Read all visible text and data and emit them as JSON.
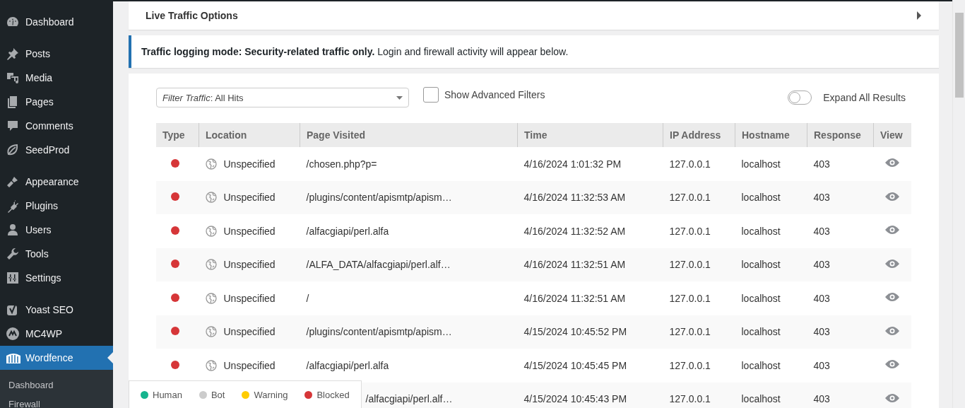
{
  "sidebar": {
    "groups": [
      [
        {
          "label": "Dashboard",
          "selected": false
        }
      ],
      [
        {
          "label": "Posts",
          "selected": false
        },
        {
          "label": "Media",
          "selected": false
        },
        {
          "label": "Pages",
          "selected": false
        },
        {
          "label": "Comments",
          "selected": false
        },
        {
          "label": "SeedProd",
          "selected": false
        }
      ],
      [
        {
          "label": "Appearance",
          "selected": false
        },
        {
          "label": "Plugins",
          "selected": false
        },
        {
          "label": "Users",
          "selected": false
        },
        {
          "label": "Tools",
          "selected": false
        },
        {
          "label": "Settings",
          "selected": false
        }
      ],
      [
        {
          "label": "Yoast SEO",
          "selected": false
        },
        {
          "label": "MC4WP",
          "selected": false
        },
        {
          "label": "Wordfence",
          "selected": true
        }
      ]
    ],
    "submenu": [
      {
        "label": "Dashboard",
        "selected": false
      },
      {
        "label": "Firewall",
        "selected": false
      }
    ]
  },
  "options_panel": {
    "title": "Live Traffic Options",
    "expanded": false
  },
  "notice": "**Traffic logging mode: Security-related traffic only.** Login and firewall activity will appear below.",
  "filter": {
    "value": "*Filter Traffic*: All Hits"
  },
  "advanced_filters": {
    "label": "Show Advanced Filters",
    "checked": false
  },
  "expand_all": {
    "label": "Expand All Results",
    "on": false
  },
  "table": {
    "columns": [
      "Type",
      "Location",
      "Page Visited",
      "Time",
      "IP Address",
      "Hostname",
      "Response",
      "View"
    ],
    "rows": [
      {
        "color": "#d63638",
        "location": "Unspecified",
        "page": "/chosen.php?p=",
        "time": "4/16/2024 1:01:32 PM",
        "ip": "127.0.0.1",
        "hostname": "localhost",
        "response": "403"
      },
      {
        "color": "#d63638",
        "location": "Unspecified",
        "page": "/plugins/content/apismtp/apism…",
        "time": "4/16/2024 11:32:53 AM",
        "ip": "127.0.0.1",
        "hostname": "localhost",
        "response": "403"
      },
      {
        "color": "#d63638",
        "location": "Unspecified",
        "page": "/alfacgiapi/perl.alfa",
        "time": "4/16/2024 11:32:52 AM",
        "ip": "127.0.0.1",
        "hostname": "localhost",
        "response": "403"
      },
      {
        "color": "#d63638",
        "location": "Unspecified",
        "page": "/ALFA_DATA/alfacgiapi/perl.alf…",
        "time": "4/16/2024 11:32:51 AM",
        "ip": "127.0.0.1",
        "hostname": "localhost",
        "response": "403"
      },
      {
        "color": "#d63638",
        "location": "Unspecified",
        "page": "/",
        "time": "4/16/2024 11:32:51 AM",
        "ip": "127.0.0.1",
        "hostname": "localhost",
        "response": "403"
      },
      {
        "color": "#d63638",
        "location": "Unspecified",
        "page": "/plugins/content/apismtp/apism…",
        "time": "4/15/2024 10:45:52 PM",
        "ip": "127.0.0.1",
        "hostname": "localhost",
        "response": "403"
      },
      {
        "color": "#d63638",
        "location": "Unspecified",
        "page": "/alfacgiapi/perl.alfa",
        "time": "4/15/2024 10:45:45 PM",
        "ip": "127.0.0.1",
        "hostname": "localhost",
        "response": "403"
      },
      {
        "page": "/alfacgiapi/perl.alf…",
        "time": "4/15/2024 10:45:43 PM",
        "ip": "127.0.0.1",
        "hostname": "localhost",
        "response": "403"
      }
    ]
  },
  "legend": [
    {
      "label": "Human",
      "color": "#16b48e"
    },
    {
      "label": "Bot",
      "color": "#cccccc"
    },
    {
      "label": "Warning",
      "color": "#ffcc00"
    },
    {
      "label": "Blocked",
      "color": "#d63638"
    }
  ]
}
